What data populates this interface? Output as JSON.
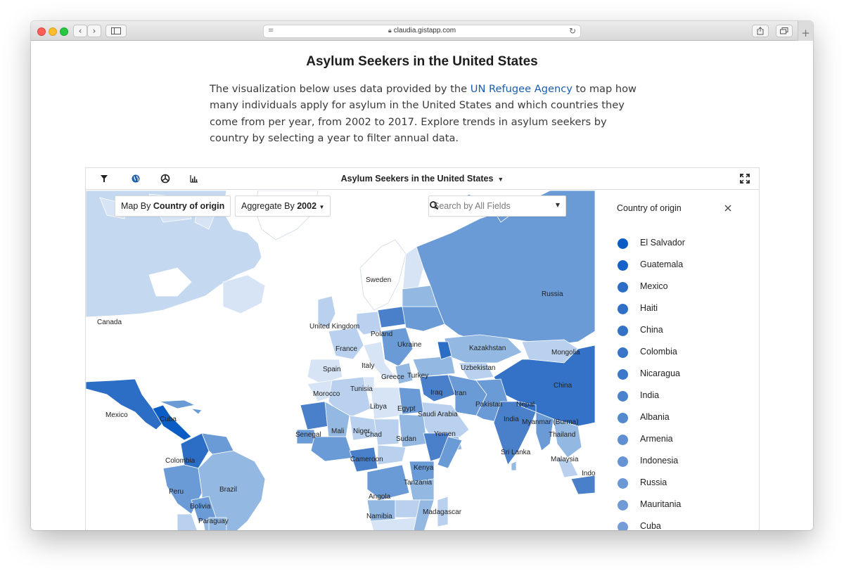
{
  "browser": {
    "url": "claudia.gistapp.com"
  },
  "article": {
    "title": "Asylum Seekers in the United States",
    "intro_before": "The visualization below uses data provided by the ",
    "intro_link": "UN Refugee Agency",
    "intro_after": " to map how many individuals apply for asylum in the United States and which countries they come from per year, from 2002 to 2017. Explore trends in asylum seekers by country by selecting a year to filter annual data."
  },
  "viz": {
    "title": "Asylum Seekers in the United States",
    "toolbar_icons": [
      "filter-icon",
      "globe-icon",
      "pie-chart-icon",
      "bar-chart-icon",
      "expand-icon"
    ],
    "map_by_prefix": "Map By",
    "map_by_value": "Country of origin",
    "aggregate_prefix": "Aggregate By",
    "aggregate_value": "2002",
    "search_placeholder": "Search by All Fields"
  },
  "legend": {
    "title": "Country of origin",
    "items": [
      {
        "label": "El Salvador",
        "color": "#0b5cc5"
      },
      {
        "label": "Guatemala",
        "color": "#1262c7"
      },
      {
        "label": "Mexico",
        "color": "#2c6dc6"
      },
      {
        "label": "Haiti",
        "color": "#2f6fc7"
      },
      {
        "label": "China",
        "color": "#3372c7"
      },
      {
        "label": "Colombia",
        "color": "#3875c8"
      },
      {
        "label": "Nicaragua",
        "color": "#3c78c9"
      },
      {
        "label": "India",
        "color": "#4b82cc"
      },
      {
        "label": "Albania",
        "color": "#5589cf"
      },
      {
        "label": "Armenia",
        "color": "#5e8fd2"
      },
      {
        "label": "Indonesia",
        "color": "#6794d4"
      },
      {
        "label": "Russia",
        "color": "#6b97d5"
      },
      {
        "label": "Mauritania",
        "color": "#6f9ad6"
      },
      {
        "label": "Cuba",
        "color": "#749dd7"
      }
    ]
  },
  "map": {
    "colors": {
      "darkest": "#2c6dc6",
      "dark": "#4a7fc9",
      "mid": "#6b9bd6",
      "light": "#93b8e2",
      "lighter": "#b9d1ee",
      "pale": "#d3e2f4",
      "white": "#ffffff",
      "border": "#ffffff"
    },
    "labels": [
      "Canada",
      "Sweden",
      "Russia",
      "United Kingdom",
      "Poland",
      "Ukraine",
      "France",
      "Kazakhstan",
      "Mongolia",
      "Spain",
      "Italy",
      "Uzbekistan",
      "Greece",
      "Turkey",
      "China",
      "Tunisia",
      "Iraq",
      "Morocco",
      "Iran",
      "Libya",
      "Egypt",
      "Pakistan",
      "Nepal",
      "Mexico",
      "Cuba",
      "Saudi Arabia",
      "India",
      "Myanmar (Burma)",
      "Mali",
      "Niger",
      "Senegal",
      "Chad",
      "Sudan",
      "Yemen",
      "Thailand",
      "Colombia",
      "Cameroon",
      "Sri Lanka",
      "Kenya",
      "Malaysia",
      "Peru",
      "Brazil",
      "Tanzania",
      "Bolivia",
      "Angola",
      "Paraguay",
      "Madagascar",
      "Namibia",
      "Indo"
    ]
  }
}
